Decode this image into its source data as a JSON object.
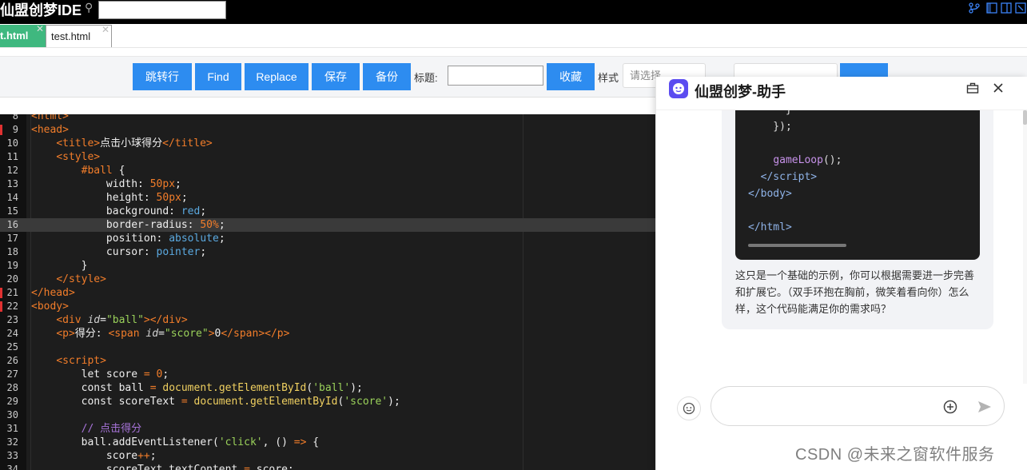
{
  "app": {
    "title": "仙盟创梦IDE",
    "search_value": ""
  },
  "tabs": [
    {
      "label": "t.html",
      "close": "✕",
      "active": true
    },
    {
      "label": "test.html",
      "close": "✕",
      "active": false
    }
  ],
  "toolbar": {
    "goto_label": "跳转行",
    "find_label": "Find",
    "replace_label": "Replace",
    "save_label": "保存",
    "backup_label": "备份",
    "title_label": "标题:",
    "title_value": "",
    "favorite_label": "收藏",
    "style_label": "样式",
    "style_placeholder": "请选择"
  },
  "editor": {
    "current_line": 16,
    "gutter_markers": [
      9,
      21,
      22
    ],
    "lines": [
      {
        "n": 8,
        "html": "<span class=\"tag\">&lt;html&gt;</span>"
      },
      {
        "n": 9,
        "html": "<span class=\"tag\">&lt;head&gt;</span>"
      },
      {
        "n": 10,
        "html": "    <span class=\"tag\">&lt;title&gt;</span>点击小球得分<span class=\"tag\">&lt;/title&gt;</span>"
      },
      {
        "n": 11,
        "html": "    <span class=\"tag\">&lt;style&gt;</span>"
      },
      {
        "n": 12,
        "html": "        <span class=\"sel\">#ball</span> {"
      },
      {
        "n": 13,
        "html": "            width: <span class=\"num\">50px</span>;"
      },
      {
        "n": 14,
        "html": "            height: <span class=\"num\">50px</span>;"
      },
      {
        "n": 15,
        "html": "            background: <span class=\"kwv\">red</span>;"
      },
      {
        "n": 16,
        "html": "            border-radius: <span class=\"num\">50%</span>;"
      },
      {
        "n": 17,
        "html": "            position: <span class=\"kwv\">absolute</span>;"
      },
      {
        "n": 18,
        "html": "            cursor: <span class=\"kwv\">pointer</span>;"
      },
      {
        "n": 19,
        "html": "        }"
      },
      {
        "n": 20,
        "html": "    <span class=\"tag\">&lt;/style&gt;</span>"
      },
      {
        "n": 21,
        "html": "<span class=\"tag\">&lt;/head&gt;</span>"
      },
      {
        "n": 22,
        "html": "<span class=\"tag\">&lt;body&gt;</span>"
      },
      {
        "n": 23,
        "html": "    <span class=\"tag\">&lt;div</span> <span class=\"attr\">id</span>=<span class=\"str\">\"ball\"</span><span class=\"tag\">&gt;&lt;/div&gt;</span>"
      },
      {
        "n": 24,
        "html": "    <span class=\"tag\">&lt;p&gt;</span>得分: <span class=\"tag\">&lt;span</span> <span class=\"attr\">id</span>=<span class=\"str\">\"score\"</span><span class=\"tag\">&gt;</span>0<span class=\"tag\">&lt;/span&gt;&lt;/p&gt;</span>"
      },
      {
        "n": 25,
        "html": ""
      },
      {
        "n": 26,
        "html": "    <span class=\"tag\">&lt;script&gt;</span>"
      },
      {
        "n": 27,
        "html": "        let score <span class=\"op\">=</span> <span class=\"num\">0</span>;"
      },
      {
        "n": 28,
        "html": "        const ball <span class=\"op\">=</span> <span class=\"fn\">document.getElementById</span>(<span class=\"str\">'ball'</span>);"
      },
      {
        "n": 29,
        "html": "        const scoreText <span class=\"op\">=</span> <span class=\"fn\">document.getElementById</span>(<span class=\"str\">'score'</span>);"
      },
      {
        "n": 30,
        "html": ""
      },
      {
        "n": 31,
        "html": "        <span class=\"cmt\">// 点击得分</span>"
      },
      {
        "n": 32,
        "html": "        ball.addEventListener(<span class=\"str\">'click'</span>, () <span class=\"op\">=&gt;</span> {"
      },
      {
        "n": 33,
        "html": "            score<span class=\"op\">++</span>;"
      },
      {
        "n": 34,
        "html": "            scoreText.textContent <span class=\"op\">=</span> score;"
      }
    ]
  },
  "assistant": {
    "title": "仙盟创梦-助手",
    "code_lines": [
      {
        "html": "      }"
      },
      {
        "html": "    });"
      },
      {
        "html": ""
      },
      {
        "html": "    <span class=\"cb-fn\">gameLoop</span>();"
      },
      {
        "html": "  <span class=\"cb-tag\">&lt;/script&gt;</span>"
      },
      {
        "html": "<span class=\"cb-tag\">&lt;/body&gt;</span>"
      },
      {
        "html": ""
      },
      {
        "html": "<span class=\"cb-tag\">&lt;/html&gt;</span>"
      }
    ],
    "message_text": "这只是一个基础的示例，你可以根据需要进一步完善和扩展它。（双手环抱在胸前，微笑着看向你）怎么样，这个代码能满足你的需求吗？",
    "input_value": ""
  },
  "watermark": "CSDN @未来之窗软件服务",
  "colors": {
    "primary_button": "#2d8cf0",
    "active_tab": "#3fb87f",
    "editor_bg": "#1d1d1d",
    "tag": "#f27d2a",
    "string": "#9ad15a"
  }
}
